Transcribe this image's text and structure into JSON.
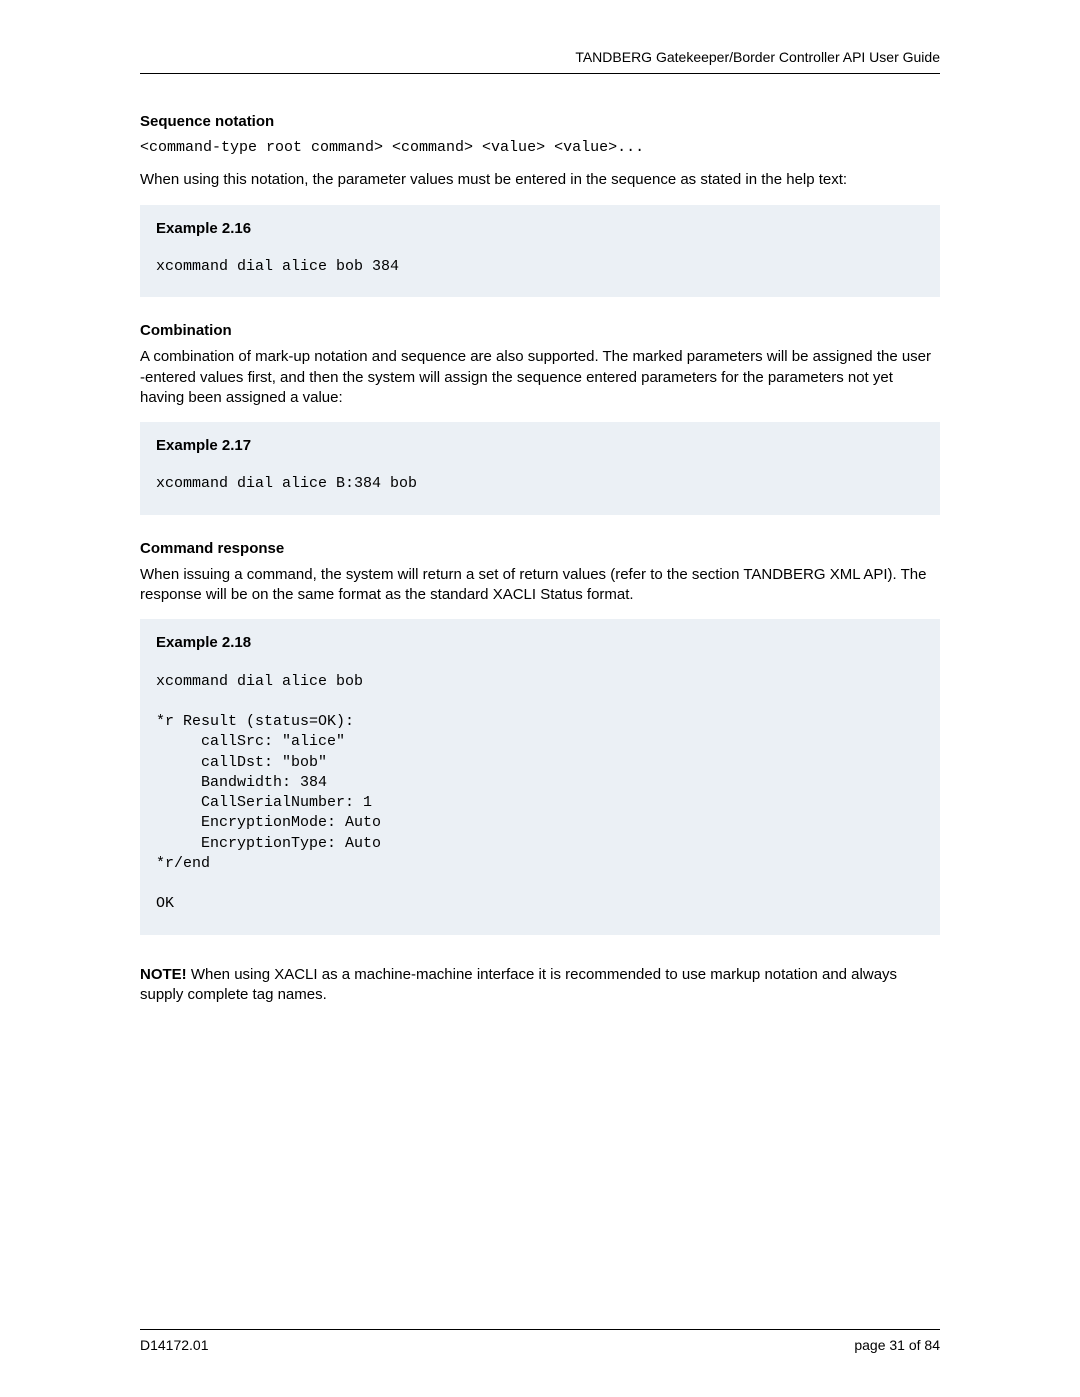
{
  "header": {
    "title": "TANDBERG Gatekeeper/Border Controller API User Guide"
  },
  "sections": {
    "seq_notation": {
      "title": "Sequence notation",
      "code": "<command-type root command> <command> <value> <value>...",
      "body": "When using this notation, the parameter values must be entered in the sequence as stated in the help text:"
    },
    "combination": {
      "title": "Combination",
      "body": "A combination of mark-up notation and sequence are also supported. The marked parameters will be assigned the user -entered values first, and then the system will assign the sequence entered parameters for the parameters not yet having been assigned a value:"
    },
    "cmd_response": {
      "title": "Command response",
      "body": "When issuing a command, the system will return a set of return values (refer to the section TANDBERG XML API). The response will be on the same format as the standard XACLI Status format."
    }
  },
  "examples": {
    "e216": {
      "title": "Example 2.16",
      "code": "xcommand dial alice bob 384"
    },
    "e217": {
      "title": "Example 2.17",
      "code": "xcommand dial alice B:384 bob"
    },
    "e218": {
      "title": "Example 2.18",
      "code": "xcommand dial alice bob\n\n*r Result (status=OK):\n     callSrc: \"alice\"\n     callDst: \"bob\"\n     Bandwidth: 384\n     CallSerialNumber: 1\n     EncryptionMode: Auto\n     EncryptionType: Auto\n*r/end\n\nOK"
    }
  },
  "note": {
    "label": "NOTE!",
    "text": " When using XACLI as a machine-machine interface it is recommended to use markup notation and always supply complete tag names."
  },
  "footer": {
    "doc_id": "D14172.01",
    "page": "page 31 of 84"
  }
}
